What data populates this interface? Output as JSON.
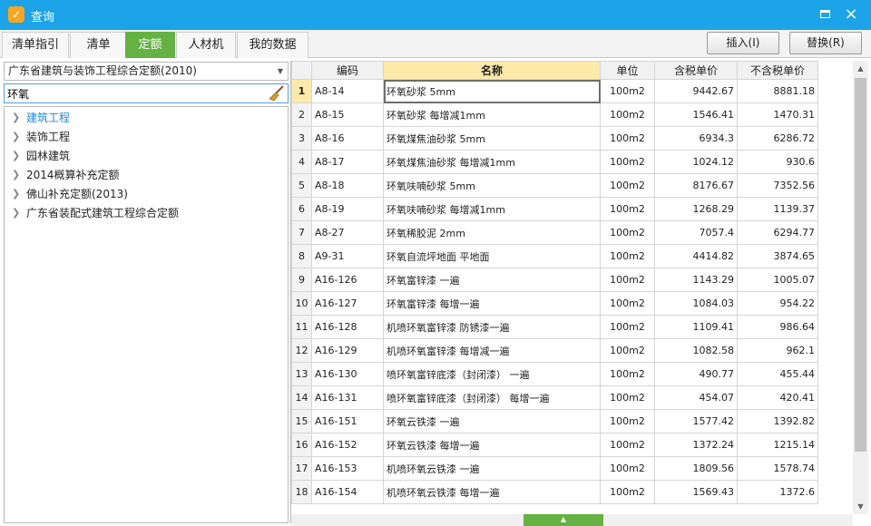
{
  "window": {
    "title": "查询",
    "app_icon_glyph": "✓",
    "accent": "#1ca3e8"
  },
  "tabs": [
    {
      "label": "清单指引",
      "active": false
    },
    {
      "label": "清单",
      "active": false
    },
    {
      "label": "定额",
      "active": true
    },
    {
      "label": "人材机",
      "active": false
    },
    {
      "label": "我的数据",
      "active": false
    }
  ],
  "actions": {
    "insert_label": "插入(I)",
    "replace_label": "替换(R)"
  },
  "left": {
    "library_select": "广东省建筑与装饰工程综合定额(2010)",
    "search_value": "环氧",
    "tree": [
      {
        "label": "建筑工程",
        "selected": true
      },
      {
        "label": "装饰工程",
        "selected": false
      },
      {
        "label": "园林建筑",
        "selected": false
      },
      {
        "label": "2014概算补充定额",
        "selected": false
      },
      {
        "label": "佛山补充定额(2013)",
        "selected": false
      },
      {
        "label": "广东省装配式建筑工程综合定额",
        "selected": false
      }
    ]
  },
  "grid": {
    "headers": {
      "code": "编码",
      "name": "名称",
      "unit": "单位",
      "price_tax": "含税单价",
      "price_notax": "不含税单价"
    },
    "rows": [
      {
        "no": "1",
        "code": "A8-14",
        "name": "环氧砂浆 5mm",
        "unit": "100m2",
        "price_tax": "9442.67",
        "price_notax": "8881.18"
      },
      {
        "no": "2",
        "code": "A8-15",
        "name": "环氧砂浆 每增减1mm",
        "unit": "100m2",
        "price_tax": "1546.41",
        "price_notax": "1470.31"
      },
      {
        "no": "3",
        "code": "A8-16",
        "name": "环氧煤焦油砂浆 5mm",
        "unit": "100m2",
        "price_tax": "6934.3",
        "price_notax": "6286.72"
      },
      {
        "no": "4",
        "code": "A8-17",
        "name": "环氧煤焦油砂浆 每增减1mm",
        "unit": "100m2",
        "price_tax": "1024.12",
        "price_notax": "930.6"
      },
      {
        "no": "5",
        "code": "A8-18",
        "name": "环氧呋喃砂浆 5mm",
        "unit": "100m2",
        "price_tax": "8176.67",
        "price_notax": "7352.56"
      },
      {
        "no": "6",
        "code": "A8-19",
        "name": "环氧呋喃砂浆 每增减1mm",
        "unit": "100m2",
        "price_tax": "1268.29",
        "price_notax": "1139.37"
      },
      {
        "no": "7",
        "code": "A8-27",
        "name": "环氧稀胶泥 2mm",
        "unit": "100m2",
        "price_tax": "7057.4",
        "price_notax": "6294.77"
      },
      {
        "no": "8",
        "code": "A9-31",
        "name": "环氧自流坪地面 平地面",
        "unit": "100m2",
        "price_tax": "4414.82",
        "price_notax": "3874.65"
      },
      {
        "no": "9",
        "code": "A16-126",
        "name": "环氧富锌漆 一遍",
        "unit": "100m2",
        "price_tax": "1143.29",
        "price_notax": "1005.07"
      },
      {
        "no": "10",
        "code": "A16-127",
        "name": "环氧富锌漆 每增一遍",
        "unit": "100m2",
        "price_tax": "1084.03",
        "price_notax": "954.22"
      },
      {
        "no": "11",
        "code": "A16-128",
        "name": "机喷环氧富锌漆 防锈漆一遍",
        "unit": "100m2",
        "price_tax": "1109.41",
        "price_notax": "986.64"
      },
      {
        "no": "12",
        "code": "A16-129",
        "name": "机喷环氧富锌漆 每增减一遍",
        "unit": "100m2",
        "price_tax": "1082.58",
        "price_notax": "962.1"
      },
      {
        "no": "13",
        "code": "A16-130",
        "name": "喷环氧富锌底漆（封闭漆） 一遍",
        "unit": "100m2",
        "price_tax": "490.77",
        "price_notax": "455.44"
      },
      {
        "no": "14",
        "code": "A16-131",
        "name": "喷环氧富锌底漆（封闭漆） 每增一遍",
        "unit": "100m2",
        "price_tax": "454.07",
        "price_notax": "420.41"
      },
      {
        "no": "15",
        "code": "A16-151",
        "name": "环氧云铁漆 一遍",
        "unit": "100m2",
        "price_tax": "1577.42",
        "price_notax": "1392.82"
      },
      {
        "no": "16",
        "code": "A16-152",
        "name": "环氧云铁漆 每增一遍",
        "unit": "100m2",
        "price_tax": "1372.24",
        "price_notax": "1215.14"
      },
      {
        "no": "17",
        "code": "A16-153",
        "name": "机喷环氧云铁漆 一遍",
        "unit": "100m2",
        "price_tax": "1809.56",
        "price_notax": "1578.74"
      },
      {
        "no": "18",
        "code": "A16-154",
        "name": "机喷环氧云铁漆 每增一遍",
        "unit": "100m2",
        "price_tax": "1569.43",
        "price_notax": "1372.6"
      }
    ]
  }
}
